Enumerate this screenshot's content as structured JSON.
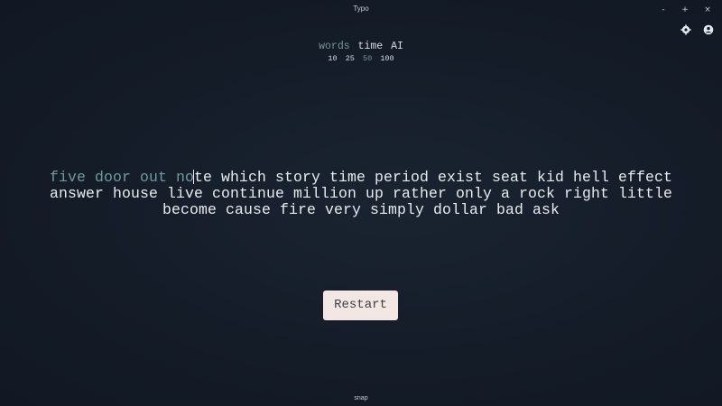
{
  "window": {
    "title": "Typo",
    "controls": {
      "minimize": "-",
      "maximize": "+",
      "close": "×"
    }
  },
  "header_icons": [
    "settings-icon",
    "account-icon"
  ],
  "modes": {
    "items": [
      "words",
      "time",
      "AI"
    ],
    "active": "words"
  },
  "counts": {
    "items": [
      "10",
      "25",
      "50",
      "100"
    ],
    "active": "50"
  },
  "typing": {
    "typed": "five door out no",
    "line1_rest": "te which story time period exist seat kid hell effect",
    "line2": "answer house live continue million up rather only a rock right little",
    "line3": "become cause fire very simply dollar bad ask"
  },
  "restart_label": "Restart",
  "footer": "snap",
  "colors": {
    "background": "#131b27",
    "accent": "#6f9a9b",
    "text": "#e9ecef",
    "button_bg": "#f3e7e4"
  }
}
